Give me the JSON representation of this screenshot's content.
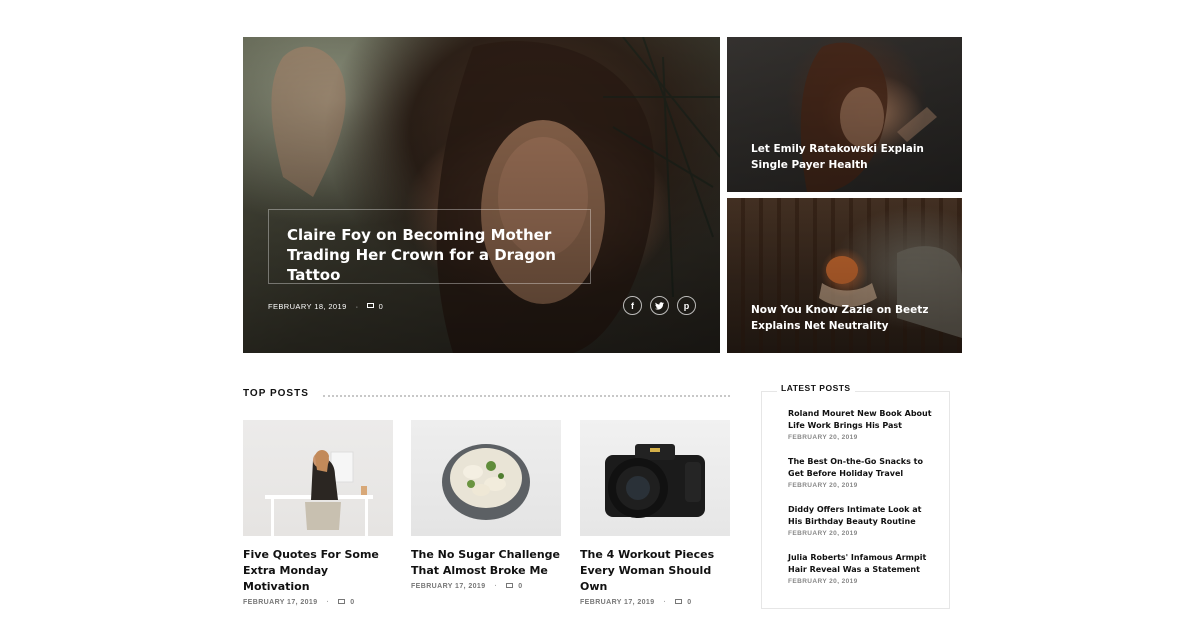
{
  "hero": {
    "title": "Claire Foy on Becoming Mother Trading Her Crown for a Dragon Tattoo",
    "date": "FEBRUARY 18, 2019",
    "comments": "0",
    "share": {
      "facebook": "f",
      "twitter": "t",
      "pinterest": "p"
    }
  },
  "side": [
    {
      "title": "Let Emily Ratakowski Explain Single Payer Health"
    },
    {
      "title": "Now You Know Zazie on Beetz Explains Net Neutrality"
    }
  ],
  "top_posts": {
    "label": "TOP POSTS",
    "items": [
      {
        "title": "Five Quotes For Some Extra Monday Motivation",
        "date": "FEBRUARY 17, 2019",
        "comments": "0"
      },
      {
        "title": "The No Sugar Challenge That Almost Broke Me",
        "date": "FEBRUARY 17, 2019",
        "comments": "0"
      },
      {
        "title": "The 4 Workout Pieces Every Woman Should Own",
        "date": "FEBRUARY 17, 2019",
        "comments": "0"
      }
    ]
  },
  "latest_posts": {
    "label": "LATEST POSTS",
    "items": [
      {
        "title": "Roland Mouret New Book About Life Work Brings His Past",
        "date": "FEBRUARY 20, 2019"
      },
      {
        "title": "The Best On-the-Go Snacks to Get Before Holiday Travel",
        "date": "FEBRUARY 20, 2019"
      },
      {
        "title": "Diddy Offers Intimate Look at His Birthday Beauty Routine",
        "date": "FEBRUARY 20, 2019"
      },
      {
        "title": "Julia Roberts' Infamous Armpit Hair Reveal Was a Statement",
        "date": "FEBRUARY 20, 2019"
      }
    ]
  },
  "icons": {
    "comment": "comment-icon",
    "facebook": "facebook-icon",
    "twitter": "twitter-icon",
    "pinterest": "pinterest-icon"
  }
}
